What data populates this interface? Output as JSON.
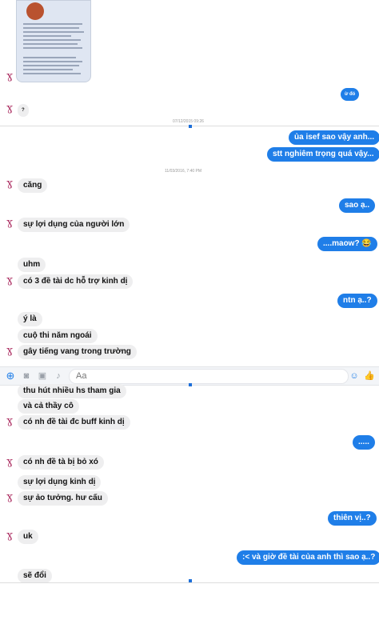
{
  "composer": {
    "placeholder": "Aa",
    "icons": [
      "plus-icon",
      "camera-icon",
      "image-icon",
      "mic-icon",
      "emoji-icon",
      "like-icon"
    ]
  },
  "accent_color": "#1f7ee8",
  "timestamps": [
    "07/12/2015 09:26",
    "11/03/2016, 7:40 PM"
  ],
  "messages": [
    {
      "from": "me",
      "text": "ừ đó"
    },
    {
      "from": "them",
      "text": "?"
    },
    {
      "from": "me",
      "text": "ủa isef sao vậy anh..."
    },
    {
      "from": "me",
      "text": "stt nghiêm trọng quá vậy..."
    },
    {
      "from": "them",
      "text": "căng"
    },
    {
      "from": "me",
      "text": "sao ạ.."
    },
    {
      "from": "them",
      "text": "sự lợi dụng của người lớn"
    },
    {
      "from": "me",
      "text": "....maow? 😂"
    },
    {
      "from": "them",
      "text": "uhm"
    },
    {
      "from": "them",
      "text": "có 3 đề tài dc hỗ trợ kinh dị"
    },
    {
      "from": "me",
      "text": "ntn ạ..?"
    },
    {
      "from": "them",
      "text": "ý là"
    },
    {
      "from": "them",
      "text": "cuộ thi năm ngoái"
    },
    {
      "from": "them",
      "text": "gây tiếng vang trong trường"
    },
    {
      "from": "them",
      "text": "thu hút nhiều hs tham gia"
    },
    {
      "from": "them",
      "text": "và cả thầy cô"
    },
    {
      "from": "them",
      "text": "có nh đề tài đc buff kinh dị"
    },
    {
      "from": "me",
      "text": "....."
    },
    {
      "from": "them",
      "text": "có nh đề tà bị bỏ xó"
    },
    {
      "from": "them",
      "text": "sự lợi dụng kinh dị"
    },
    {
      "from": "them",
      "text": "sự ảo tưởng. hư cấu"
    },
    {
      "from": "me",
      "text": "thiên vị..?"
    },
    {
      "from": "them",
      "text": "uk"
    },
    {
      "from": "me",
      "text": ":< và giờ đề tài của anh thì sao ạ..?"
    },
    {
      "from": "them",
      "text": "sẽ đổi"
    }
  ]
}
